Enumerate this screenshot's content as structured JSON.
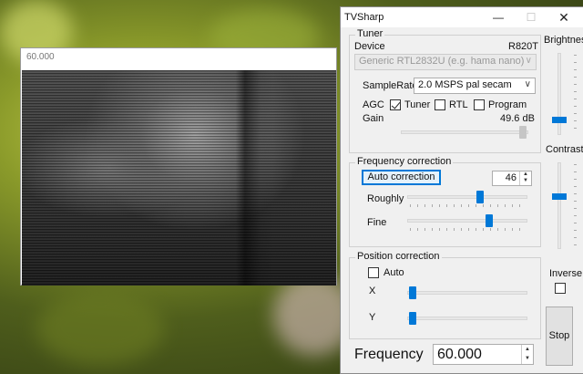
{
  "video_window": {
    "title": "60.000"
  },
  "app": {
    "title": "TVSharp"
  },
  "tuner": {
    "group_label": "Tuner",
    "device_label": "Device",
    "device_model": "R820T",
    "device_select": "Generic RTL2832U (e.g. hama nano)",
    "samplerate_label": "SampleRate",
    "samplerate_select": "2.0 MSPS pal secam",
    "agc_label": "AGC",
    "tuner_label": "Tuner",
    "tuner_checked": true,
    "rtl_label": "RTL",
    "rtl_checked": false,
    "program_label": "Program",
    "program_checked": false,
    "gain_label": "Gain",
    "gain_value": "49.6 dB"
  },
  "frequency_correction": {
    "group_label": "Frequency correction",
    "auto_button": "Auto correction",
    "value": "46",
    "roughly_label": "Roughly",
    "fine_label": "Fine"
  },
  "position_correction": {
    "group_label": "Position correction",
    "auto_label": "Auto",
    "auto_checked": false,
    "x_label": "X",
    "y_label": "Y"
  },
  "side": {
    "brightness_label": "Brightnes",
    "contrast_label": "Contrast",
    "inverse_label": "Inverse",
    "inverse_checked": false,
    "stop_button": "Stop"
  },
  "frequency": {
    "label": "Frequency",
    "value": "60.000"
  },
  "colors": {
    "accent": "#0078d7",
    "window_bg": "#f0f0f0"
  }
}
